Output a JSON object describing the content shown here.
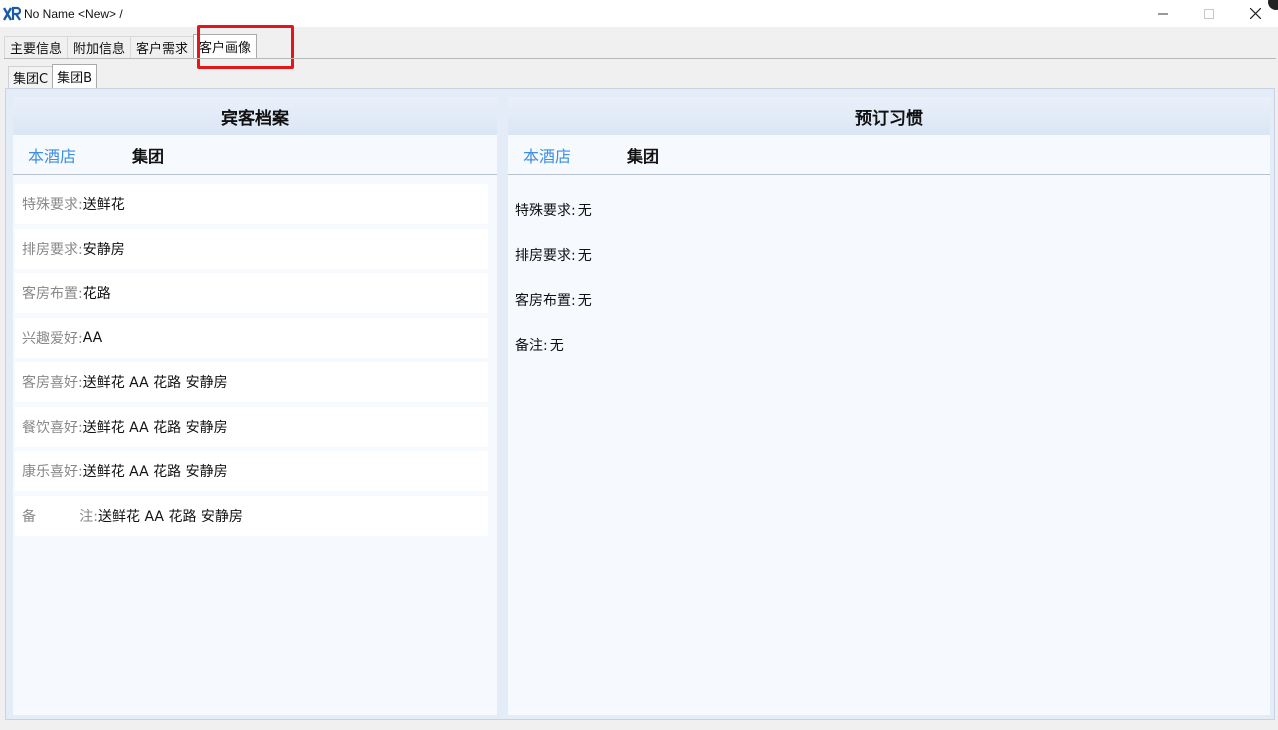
{
  "window": {
    "title": "No Name <New> /",
    "minimize_icon": "minimize-icon",
    "maximize_icon": "maximize-icon",
    "close_icon": "close-icon"
  },
  "main_tabs": [
    {
      "label": "主要信息"
    },
    {
      "label": "附加信息"
    },
    {
      "label": "客户需求"
    },
    {
      "label": "客户画像",
      "active": true
    }
  ],
  "sub_tabs": [
    {
      "label": "集团C"
    },
    {
      "label": "集团B",
      "active": true
    }
  ],
  "guest_profile": {
    "title": "宾客档案",
    "tab_hotel": "本酒店",
    "tab_group": "集团",
    "fields": [
      {
        "label": "特殊要求:",
        "value": "送鲜花"
      },
      {
        "label": "排房要求:",
        "value": "安静房"
      },
      {
        "label": "客房布置:",
        "value": "花路"
      },
      {
        "label": "兴趣爱好:",
        "value": "AA"
      },
      {
        "label": "客房喜好:",
        "value": "送鲜花 AA 花路 安静房"
      },
      {
        "label": "餐饮喜好:",
        "value": "送鲜花 AA 花路 安静房"
      },
      {
        "label": "康乐喜好:",
        "value": "送鲜花 AA 花路 安静房"
      }
    ],
    "remark": {
      "label_a": "备",
      "label_b": "注:",
      "value": "送鲜花 AA 花路 安静房"
    }
  },
  "booking_habits": {
    "title": "预订习惯",
    "tab_hotel": "本酒店",
    "tab_group": "集团",
    "fields": [
      {
        "label": "特殊要求:",
        "value": "无"
      },
      {
        "label": "排房要求:",
        "value": "无"
      },
      {
        "label": "客房布置:",
        "value": "无"
      },
      {
        "label": "备注:",
        "value": "无"
      }
    ]
  },
  "colors": {
    "accent_blue": "#3f8fe0",
    "highlight_red": "#e3161c",
    "panel_bg": "#f6f9fe"
  }
}
